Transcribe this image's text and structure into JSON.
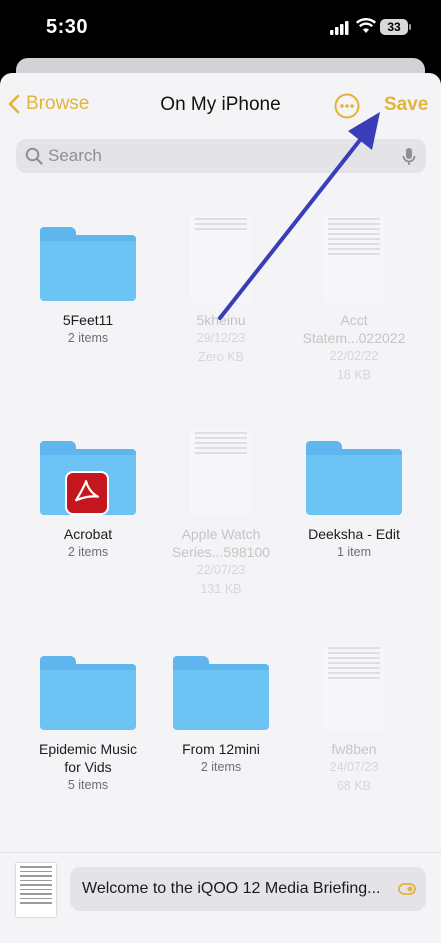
{
  "status": {
    "time": "5:30",
    "battery": "33"
  },
  "nav": {
    "back_label": "Browse",
    "title": "On My iPhone",
    "save_label": "Save"
  },
  "search": {
    "placeholder": "Search",
    "value": ""
  },
  "items": [
    {
      "name": "5Feet11",
      "meta1": "2 items",
      "meta2": "",
      "meta3": "",
      "type": "folder"
    },
    {
      "name": "5kheinu",
      "meta1": "29/12/23",
      "meta2": "Zero KB",
      "meta3": "",
      "type": "file"
    },
    {
      "name": "Acct",
      "name2": "Statem...022022",
      "meta1": "22/02/22",
      "meta2": "18 KB",
      "type": "file"
    },
    {
      "name": "Acrobat",
      "meta1": "2 items",
      "type": "folder"
    },
    {
      "name": "Apple Watch",
      "name2": "Series...598100",
      "meta1": "22/07/23",
      "meta2": "131 KB",
      "type": "file"
    },
    {
      "name": "Deeksha - Edit",
      "meta1": "1 item",
      "type": "folder"
    },
    {
      "name": "Epidemic Music",
      "name2": "for Vids",
      "meta1": "5 items",
      "type": "folder"
    },
    {
      "name": "From 12mini",
      "meta1": "2 items",
      "type": "folder"
    },
    {
      "name": "fw8ben",
      "meta1": "24/07/23",
      "meta2": "68 KB",
      "type": "file"
    }
  ],
  "bottom": {
    "filename": "Welcome to the iQOO 12 Media Briefing..."
  },
  "colors": {
    "accent": "#e6b33a",
    "folder": "#6ec3f5",
    "annotation_arrow": "#3a3db8"
  }
}
